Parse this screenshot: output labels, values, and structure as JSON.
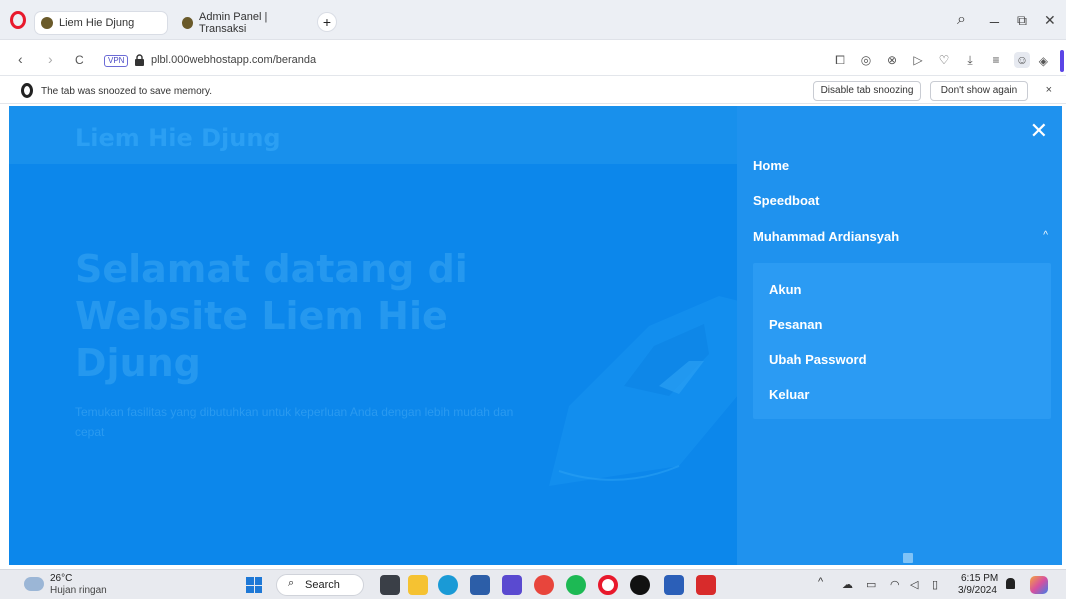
{
  "browser": {
    "tabs": [
      {
        "title": "Liem Hie Djung",
        "active": true
      },
      {
        "title": "Admin Panel | Transaksi",
        "active": false
      }
    ],
    "new_tab": "+",
    "window_controls": {
      "search": "⌕",
      "minimize": "_",
      "restore": "⧉",
      "close": "✕"
    },
    "nav": {
      "back": "‹",
      "forward": "›",
      "reload": "C"
    },
    "vpn_label": "VPN",
    "url": "plbl.000webhostapp.com/beranda",
    "toolbar_icons": [
      "snapshot-icon",
      "camera-icon",
      "shield-icon",
      "play-icon",
      "heart-icon",
      "download-icon",
      "menu-icon",
      "profile-icon",
      "extensions-icon"
    ],
    "accent_color": "#5b45e6"
  },
  "infobar": {
    "message": "The tab was snoozed to save memory.",
    "disable_button": "Disable tab snoozing",
    "dismiss_button": "Don't show again",
    "close": "×"
  },
  "page": {
    "site_title": "Liem Hie Djung",
    "hero_title": "Selamat datang di Website Liem Hie Djung",
    "hero_description": "Temukan fasilitas yang dibutuhkan untuk keperluan Anda dengan lebih mudah dan cepat",
    "bg_color": "#0c87eb"
  },
  "drawer": {
    "close": "✕",
    "nav_items": [
      "Home",
      "Speedboat",
      "Muhammad Ardiansyah"
    ],
    "expanded_chevron": "^",
    "submenu": [
      "Akun",
      "Pesanan",
      "Ubah Password",
      "Keluar"
    ],
    "bg_color": "#1f92ee"
  },
  "taskbar": {
    "weather_temp": "26°C",
    "weather_desc": "Hujan ringan",
    "search_label": "Search",
    "search_glyph": "⌕",
    "tray_chevron": "^",
    "clock_time": "6:15 PM",
    "clock_date": "3/9/2024",
    "apps": [
      "file-explorer-icon",
      "folder-icon",
      "edge-icon",
      "store-icon",
      "editor-icon",
      "chrome-icon",
      "spotify-icon",
      "opera-icon",
      "tiktok-icon",
      "word-icon",
      "acrobat-icon"
    ]
  }
}
